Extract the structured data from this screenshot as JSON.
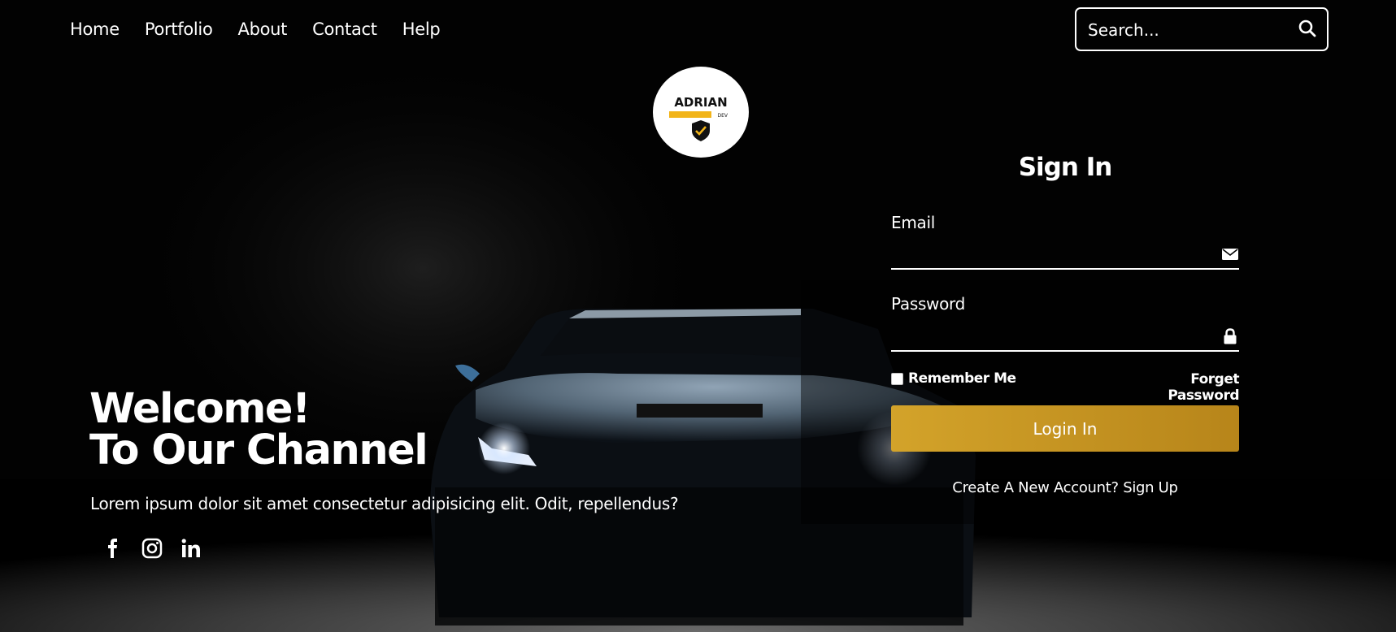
{
  "nav": {
    "items": [
      "Home",
      "Portfolio",
      "About",
      "Contact",
      "Help"
    ]
  },
  "search": {
    "placeholder": "Search..."
  },
  "logo": {
    "line1": "ADRIAN",
    "line2": "DEV",
    "accent": "#f2b419"
  },
  "hero": {
    "title": "Welcome!\nTo Our Channel",
    "text": "Lorem ipsum dolor sit amet consectetur adipisicing elit. Odit, repellendus?"
  },
  "social": [
    "facebook-icon",
    "instagram-icon",
    "linkedin-icon"
  ],
  "form": {
    "title": "Sign In",
    "email_label": "Email",
    "password_label": "Password",
    "remember_label": "Remember Me",
    "forget_label": "Forget Password",
    "login_label": "Login In",
    "signup_prefix": "Create A New Account?",
    "signup_link": "Sign Up",
    "button_color": "#c8961f"
  }
}
